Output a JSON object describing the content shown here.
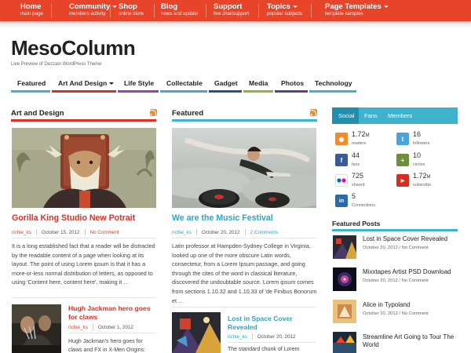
{
  "topnav": [
    {
      "title": "Home",
      "sub": "main page"
    },
    {
      "title": "Community",
      "sub": "members activity"
    },
    {
      "title": "Shop",
      "sub": "online store"
    },
    {
      "title": "Blog",
      "sub": "news and update"
    },
    {
      "title": "Support",
      "sub": "live chat/support"
    },
    {
      "title": "Topics",
      "sub": "popular subjects"
    },
    {
      "title": "Page Templates",
      "sub": "template samples"
    }
  ],
  "site": {
    "title": "MesoColumn",
    "description": "Live Preview of Dezzain WordPress Theme"
  },
  "menu": [
    {
      "label": "Featured",
      "color": "#3fb3cc"
    },
    {
      "label": "Art And Design",
      "color": "#d9302a"
    },
    {
      "label": "Life Style",
      "color": "#9b3fbf"
    },
    {
      "label": "Collectable",
      "color": "#4aa3df"
    },
    {
      "label": "Gadget",
      "color": "#2c4e9f"
    },
    {
      "label": "Media",
      "color": "#8ab833"
    },
    {
      "label": "Photos",
      "color": "#5b3e8e"
    },
    {
      "label": "Technology",
      "color": "#3fb3cc"
    }
  ],
  "left_column": {
    "title": "Art and Design",
    "rule_color": "#d9302a",
    "main_post": {
      "title": "Gorilla King Studio New Potrait",
      "author": "richie_ks",
      "date": "October 15, 2012",
      "comments": "No Comment",
      "excerpt": "It is a long established fact that a reader will be distracted by the readable content of a page when looking at its layout. The point of using Lorem ipsum is that it has a more-or-less normal distribution of letters, as opposed to using 'Content here, content here', making it ..."
    },
    "small_post": {
      "title": "Hugh Jackman hero goes for claws",
      "author": "richie_ks",
      "date": "October 1, 2012",
      "excerpt": "Hugh Jackman's hero goes for claws and FX in X-Men Origins:"
    }
  },
  "mid_column": {
    "title": "Featured",
    "rule_color": "#3fb3cc",
    "main_post": {
      "title": "We are the Music Festival",
      "author": "richie_ks",
      "date": "October 20, 2012",
      "comments": "2 Comments",
      "excerpt": "Latin professor at Hampden-Sydney College in Virginia, looked up one of the more obscure Latin words, consectetur, from a Lorem Ipsum passage, and going through the cites of the word in classical literature, discovered the undoubtable source. Lorem ipsum comes from sections 1.10.32 and 1.10.33 of 'de Finibus Bonorum et ..."
    },
    "small_post": {
      "title": "Lost in Space Cover Revealed",
      "author": "richie_ks",
      "date": "October 20, 2012",
      "excerpt": "The standard chunk of Lorem"
    }
  },
  "social": {
    "tabs": [
      "Social",
      "Fans",
      "Members"
    ],
    "items": [
      {
        "icon": "rss-icon",
        "color": "#f58a2a",
        "glyph": "◉",
        "value": "1.72",
        "unit": "M",
        "label": "readers"
      },
      {
        "icon": "twitter-icon",
        "color": "#4aa3df",
        "glyph": "t",
        "value": "16",
        "unit": "",
        "label": "followers"
      },
      {
        "icon": "facebook-icon",
        "color": "#3b5998",
        "glyph": "f",
        "value": "44",
        "unit": "",
        "label": "fans"
      },
      {
        "icon": "google-plus-icon",
        "color": "#6b8f3a",
        "glyph": "+",
        "value": "10",
        "unit": "",
        "label": "circles"
      },
      {
        "icon": "flickr-icon",
        "color": "#ff5a9e",
        "glyph": "●",
        "value": "725",
        "unit": "",
        "label": "shared"
      },
      {
        "icon": "youtube-icon",
        "color": "#d62d20",
        "glyph": "▶",
        "value": "1.72",
        "unit": "M",
        "label": "subscribe"
      },
      {
        "icon": "linkedin-icon",
        "color": "#2a6aa8",
        "glyph": "in",
        "value": "5",
        "unit": "",
        "label": "Connections"
      }
    ]
  },
  "featured_posts": {
    "title": "Featured Posts",
    "items": [
      {
        "title": "Lost in Space Cover Revealed",
        "date": "October 20, 2012",
        "comments": "No Comment"
      },
      {
        "title": "Mixxtapes Artist PSD Download",
        "date": "October 20, 2012",
        "comments": "No Comment"
      },
      {
        "title": "Alice in Typoland",
        "date": "October 20, 2012",
        "comments": "No Comment"
      },
      {
        "title": "Streamline Art Going to Tour The World",
        "date": "",
        "comments": ""
      }
    ]
  }
}
